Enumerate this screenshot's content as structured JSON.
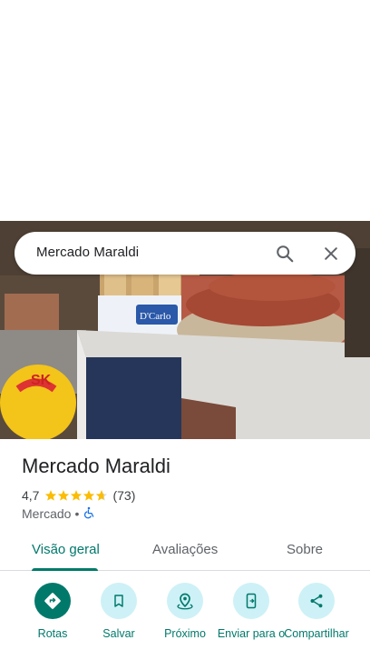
{
  "search": {
    "query": "Mercado Maraldi"
  },
  "place": {
    "name": "Mercado Maraldi",
    "rating": "4,7",
    "rating_value": 4.7,
    "reviews_count": "(73)",
    "category": "Mercado",
    "separator": "•"
  },
  "photo": {
    "sign_text": "D'Carlo"
  },
  "tabs": [
    {
      "label": "Visão geral",
      "active": true
    },
    {
      "label": "Avaliações",
      "active": false
    },
    {
      "label": "Sobre",
      "active": false
    }
  ],
  "actions": [
    {
      "label": "Rotas",
      "icon": "directions-icon"
    },
    {
      "label": "Salvar",
      "icon": "bookmark-icon"
    },
    {
      "label": "Próximo",
      "icon": "nearby-icon"
    },
    {
      "label": "Enviar para o",
      "icon": "send-to-phone-icon"
    },
    {
      "label": "Compartilhar",
      "icon": "share-icon"
    }
  ],
  "colors": {
    "accent": "#00796b",
    "action_bg": "#cdf1f6",
    "star": "#fbbc04",
    "accessibility": "#1a73e8"
  }
}
